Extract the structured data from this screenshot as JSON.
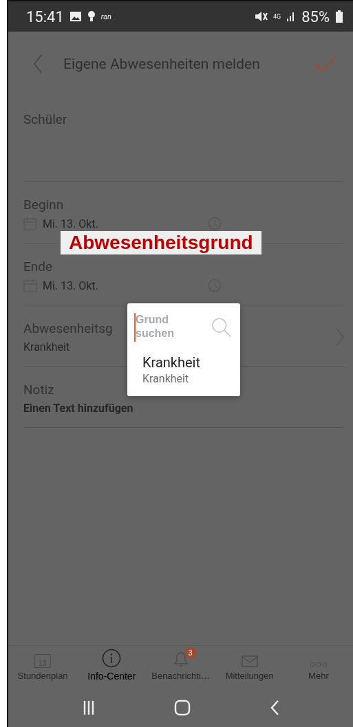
{
  "status_bar": {
    "time": "15:41",
    "carrier": "ran",
    "network": "4G",
    "battery": "85%"
  },
  "header": {
    "title": "Eigene Abwesenheiten melden"
  },
  "fields": [
    {
      "kind": "plain",
      "label": "Schüler"
    },
    {
      "kind": "datetime",
      "label": "Beginn",
      "date": "Mi. 13. Okt."
    },
    {
      "kind": "datetime",
      "label": "Ende",
      "date": "Mi. 13. Okt."
    },
    {
      "kind": "select",
      "label": "Abwesenheitsg",
      "value": "Krankheit"
    },
    {
      "kind": "note",
      "label": "Notiz",
      "value": "Einen Text hinzufügen"
    }
  ],
  "annotation": "Abwesenheitsgrund",
  "dialog": {
    "search": {
      "placeholder": "Grund suchen"
    },
    "options": [
      {
        "title": "Krankheit",
        "subtitle": "Krankheit"
      }
    ]
  },
  "tab_bar": [
    {
      "kind": "calendar",
      "label": "Stundenplan",
      "icon_text": "13",
      "selected": false
    },
    {
      "kind": "info",
      "label": "Info-Center",
      "selected": true
    },
    {
      "kind": "bell",
      "label": "Benachrichti…",
      "badge": "3",
      "selected": false
    },
    {
      "kind": "mail",
      "label": "Mitteilungen",
      "selected": false
    },
    {
      "kind": "more",
      "label": "Mehr",
      "selected": false
    }
  ]
}
